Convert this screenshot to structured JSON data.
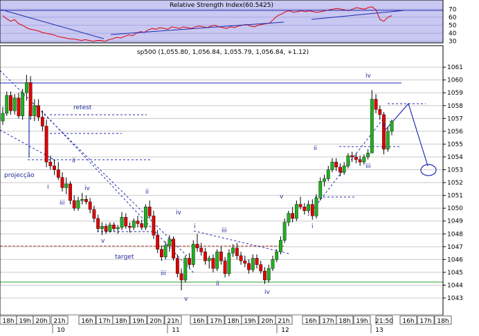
{
  "colors": {
    "rsi_bg": "#c8c8f2",
    "main_bg": "#ffffff",
    "grid": "#c8c8c8",
    "rsi_line": "#e00000",
    "trend": "#1f2ab0",
    "bull": "#21b021",
    "bear": "#e00000",
    "support": "#2aa02a",
    "target_line": "#b04020",
    "wick": "#000000"
  },
  "rsi_panel": {
    "title": "Relative Strength Index(60.5425)",
    "ticks": [
      "70",
      "60",
      "50",
      "40",
      "30"
    ]
  },
  "price_panel": {
    "title": "sp500 (1,055.80, 1,056.84, 1,055.79, 1,056.84, +1.12)",
    "price_ticks": [
      "1061",
      "1060",
      "1059",
      "1058",
      "1057",
      "1056",
      "1055",
      "1054",
      "1053",
      "1052",
      "1051",
      "1050",
      "1049",
      "1048",
      "1047",
      "1046",
      "1045",
      "1044",
      "1043"
    ]
  },
  "time_axis": {
    "hour_labels": [
      "18h",
      "19h",
      "20h",
      "21h",
      "16h",
      "17h",
      "18h",
      "19h",
      "20h",
      "21h",
      "16h",
      "17h",
      "18h",
      "19h",
      "20h",
      "21h",
      "16h",
      "17h",
      "18h",
      "19h",
      "21:50",
      "16h",
      "17h",
      "18h"
    ],
    "day_labels": [
      "10",
      "11",
      "12",
      "13"
    ]
  },
  "annotations": {
    "retest": "retest",
    "projeccao": "projecção",
    "target": "target",
    "waves": [
      "i",
      "ii",
      "iii",
      "iv",
      "v",
      "ii",
      "iii",
      "iv",
      "v",
      "i",
      "ii",
      "iii",
      "iv",
      "v",
      "i",
      "ii",
      "iii",
      "iv",
      "v"
    ]
  },
  "chart_data": {
    "type": "candlestick",
    "title": "sp500 (1,055.80, 1,056.84, 1,055.79, 1,056.84, +1.12)",
    "xlabel": "",
    "ylabel": "",
    "ylim": [
      1042.3,
      1061.6
    ],
    "candles": [
      {
        "o": 1056.8,
        "h": 1057.9,
        "l": 1056.5,
        "c": 1057.4
      },
      {
        "o": 1057.4,
        "h": 1059.1,
        "l": 1057.2,
        "c": 1058.8
      },
      {
        "o": 1058.8,
        "h": 1059.1,
        "l": 1057.3,
        "c": 1057.6
      },
      {
        "o": 1057.6,
        "h": 1058.9,
        "l": 1057.3,
        "c": 1058.6
      },
      {
        "o": 1058.6,
        "h": 1059.0,
        "l": 1057.0,
        "c": 1057.2
      },
      {
        "o": 1057.2,
        "h": 1059.3,
        "l": 1056.9,
        "c": 1059.0
      },
      {
        "o": 1059.0,
        "h": 1060.4,
        "l": 1058.4,
        "c": 1059.8
      },
      {
        "o": 1059.8,
        "h": 1060.3,
        "l": 1056.9,
        "c": 1057.2
      },
      {
        "o": 1057.2,
        "h": 1058.5,
        "l": 1056.8,
        "c": 1058.0
      },
      {
        "o": 1058.0,
        "h": 1058.5,
        "l": 1056.8,
        "c": 1057.1
      },
      {
        "o": 1057.1,
        "h": 1057.6,
        "l": 1056.0,
        "c": 1056.4
      },
      {
        "o": 1056.4,
        "h": 1056.9,
        "l": 1053.2,
        "c": 1053.6
      },
      {
        "o": 1053.6,
        "h": 1054.1,
        "l": 1053.0,
        "c": 1053.3
      },
      {
        "o": 1053.3,
        "h": 1053.8,
        "l": 1052.6,
        "c": 1053.0
      },
      {
        "o": 1053.0,
        "h": 1053.6,
        "l": 1052.2,
        "c": 1052.4
      },
      {
        "o": 1052.4,
        "h": 1052.8,
        "l": 1051.3,
        "c": 1051.6
      },
      {
        "o": 1051.6,
        "h": 1052.4,
        "l": 1051.1,
        "c": 1051.9
      },
      {
        "o": 1051.9,
        "h": 1052.1,
        "l": 1050.3,
        "c": 1050.6
      },
      {
        "o": 1050.6,
        "h": 1051.0,
        "l": 1049.8,
        "c": 1050.0
      },
      {
        "o": 1050.0,
        "h": 1050.9,
        "l": 1049.8,
        "c": 1050.6
      },
      {
        "o": 1050.6,
        "h": 1051.2,
        "l": 1050.3,
        "c": 1050.7
      },
      {
        "o": 1050.7,
        "h": 1051.0,
        "l": 1050.3,
        "c": 1050.5
      },
      {
        "o": 1050.5,
        "h": 1050.8,
        "l": 1049.6,
        "c": 1049.9
      },
      {
        "o": 1049.9,
        "h": 1050.2,
        "l": 1048.9,
        "c": 1049.2
      },
      {
        "o": 1049.2,
        "h": 1049.5,
        "l": 1048.2,
        "c": 1048.4
      },
      {
        "o": 1048.4,
        "h": 1048.9,
        "l": 1047.9,
        "c": 1048.6
      },
      {
        "o": 1048.6,
        "h": 1048.8,
        "l": 1048.0,
        "c": 1048.2
      },
      {
        "o": 1048.2,
        "h": 1048.9,
        "l": 1048.1,
        "c": 1048.7
      },
      {
        "o": 1048.7,
        "h": 1048.9,
        "l": 1048.2,
        "c": 1048.4
      },
      {
        "o": 1048.4,
        "h": 1048.7,
        "l": 1048.0,
        "c": 1048.5
      },
      {
        "o": 1048.5,
        "h": 1049.7,
        "l": 1048.3,
        "c": 1049.3
      },
      {
        "o": 1049.3,
        "h": 1049.6,
        "l": 1048.4,
        "c": 1048.6
      },
      {
        "o": 1048.6,
        "h": 1048.9,
        "l": 1048.1,
        "c": 1048.5
      },
      {
        "o": 1048.5,
        "h": 1049.2,
        "l": 1048.3,
        "c": 1049.0
      },
      {
        "o": 1049.0,
        "h": 1049.4,
        "l": 1048.5,
        "c": 1048.8
      },
      {
        "o": 1048.8,
        "h": 1049.1,
        "l": 1048.3,
        "c": 1048.5
      },
      {
        "o": 1048.5,
        "h": 1050.3,
        "l": 1048.3,
        "c": 1050.1
      },
      {
        "o": 1050.1,
        "h": 1050.6,
        "l": 1049.2,
        "c": 1049.4
      },
      {
        "o": 1049.4,
        "h": 1049.8,
        "l": 1047.6,
        "c": 1047.9
      },
      {
        "o": 1047.9,
        "h": 1048.3,
        "l": 1046.5,
        "c": 1046.8
      },
      {
        "o": 1046.8,
        "h": 1047.1,
        "l": 1045.9,
        "c": 1046.2
      },
      {
        "o": 1046.2,
        "h": 1047.4,
        "l": 1046.0,
        "c": 1047.1
      },
      {
        "o": 1047.1,
        "h": 1047.9,
        "l": 1046.6,
        "c": 1047.6
      },
      {
        "o": 1047.6,
        "h": 1047.8,
        "l": 1045.9,
        "c": 1046.1
      },
      {
        "o": 1046.1,
        "h": 1046.4,
        "l": 1044.6,
        "c": 1044.9
      },
      {
        "o": 1044.9,
        "h": 1045.3,
        "l": 1043.6,
        "c": 1044.4
      },
      {
        "o": 1044.4,
        "h": 1046.3,
        "l": 1044.2,
        "c": 1046.1
      },
      {
        "o": 1046.1,
        "h": 1046.5,
        "l": 1045.3,
        "c": 1045.6
      },
      {
        "o": 1045.6,
        "h": 1047.5,
        "l": 1045.4,
        "c": 1047.2
      },
      {
        "o": 1047.2,
        "h": 1048.0,
        "l": 1046.6,
        "c": 1046.9
      },
      {
        "o": 1046.9,
        "h": 1047.3,
        "l": 1046.3,
        "c": 1046.6
      },
      {
        "o": 1046.6,
        "h": 1046.9,
        "l": 1045.6,
        "c": 1045.9
      },
      {
        "o": 1045.9,
        "h": 1046.3,
        "l": 1045.3,
        "c": 1046.1
      },
      {
        "o": 1046.1,
        "h": 1046.4,
        "l": 1045.0,
        "c": 1045.3
      },
      {
        "o": 1045.3,
        "h": 1046.8,
        "l": 1045.1,
        "c": 1046.6
      },
      {
        "o": 1046.6,
        "h": 1047.0,
        "l": 1045.6,
        "c": 1045.9
      },
      {
        "o": 1045.9,
        "h": 1046.2,
        "l": 1044.6,
        "c": 1044.9
      },
      {
        "o": 1044.9,
        "h": 1046.8,
        "l": 1044.7,
        "c": 1046.5
      },
      {
        "o": 1046.5,
        "h": 1047.2,
        "l": 1046.2,
        "c": 1046.9
      },
      {
        "o": 1046.9,
        "h": 1047.3,
        "l": 1046.0,
        "c": 1046.3
      },
      {
        "o": 1046.3,
        "h": 1046.6,
        "l": 1045.6,
        "c": 1045.9
      },
      {
        "o": 1045.9,
        "h": 1046.3,
        "l": 1045.4,
        "c": 1045.7
      },
      {
        "o": 1045.7,
        "h": 1046.0,
        "l": 1044.9,
        "c": 1045.2
      },
      {
        "o": 1045.2,
        "h": 1046.4,
        "l": 1045.0,
        "c": 1046.1
      },
      {
        "o": 1046.1,
        "h": 1046.4,
        "l": 1045.3,
        "c": 1045.6
      },
      {
        "o": 1045.6,
        "h": 1045.9,
        "l": 1044.9,
        "c": 1045.1
      },
      {
        "o": 1045.1,
        "h": 1045.4,
        "l": 1044.1,
        "c": 1044.4
      },
      {
        "o": 1044.4,
        "h": 1045.6,
        "l": 1044.2,
        "c": 1045.3
      },
      {
        "o": 1045.3,
        "h": 1046.3,
        "l": 1045.1,
        "c": 1046.0
      },
      {
        "o": 1046.0,
        "h": 1046.8,
        "l": 1045.8,
        "c": 1046.6
      },
      {
        "o": 1046.6,
        "h": 1047.8,
        "l": 1046.4,
        "c": 1047.5
      },
      {
        "o": 1047.5,
        "h": 1049.2,
        "l": 1047.3,
        "c": 1048.9
      },
      {
        "o": 1048.9,
        "h": 1049.8,
        "l": 1048.6,
        "c": 1049.6
      },
      {
        "o": 1049.6,
        "h": 1050.1,
        "l": 1048.9,
        "c": 1049.2
      },
      {
        "o": 1049.2,
        "h": 1050.6,
        "l": 1049.0,
        "c": 1050.3
      },
      {
        "o": 1050.3,
        "h": 1050.9,
        "l": 1049.9,
        "c": 1050.1
      },
      {
        "o": 1050.1,
        "h": 1050.4,
        "l": 1049.5,
        "c": 1049.8
      },
      {
        "o": 1049.8,
        "h": 1050.6,
        "l": 1049.6,
        "c": 1050.3
      },
      {
        "o": 1050.3,
        "h": 1050.7,
        "l": 1049.1,
        "c": 1049.4
      },
      {
        "o": 1049.4,
        "h": 1051.1,
        "l": 1049.2,
        "c": 1050.8
      },
      {
        "o": 1050.8,
        "h": 1052.4,
        "l": 1050.6,
        "c": 1052.1
      },
      {
        "o": 1052.1,
        "h": 1052.6,
        "l": 1051.7,
        "c": 1052.3
      },
      {
        "o": 1052.3,
        "h": 1053.3,
        "l": 1052.1,
        "c": 1053.0
      },
      {
        "o": 1053.0,
        "h": 1053.9,
        "l": 1052.8,
        "c": 1053.6
      },
      {
        "o": 1053.6,
        "h": 1053.9,
        "l": 1052.9,
        "c": 1053.2
      },
      {
        "o": 1053.2,
        "h": 1053.5,
        "l": 1052.5,
        "c": 1052.8
      },
      {
        "o": 1052.8,
        "h": 1053.6,
        "l": 1052.6,
        "c": 1053.3
      },
      {
        "o": 1053.3,
        "h": 1054.3,
        "l": 1053.1,
        "c": 1054.1
      },
      {
        "o": 1054.1,
        "h": 1054.4,
        "l": 1053.6,
        "c": 1054.0
      },
      {
        "o": 1054.0,
        "h": 1054.3,
        "l": 1053.5,
        "c": 1053.8
      },
      {
        "o": 1053.8,
        "h": 1054.1,
        "l": 1053.3,
        "c": 1053.6
      },
      {
        "o": 1053.6,
        "h": 1054.2,
        "l": 1053.4,
        "c": 1054.0
      },
      {
        "o": 1054.0,
        "h": 1054.6,
        "l": 1053.8,
        "c": 1054.3
      },
      {
        "o": 1054.3,
        "h": 1059.2,
        "l": 1058.0,
        "c": 1058.5
      },
      {
        "o": 1058.5,
        "h": 1058.9,
        "l": 1057.4,
        "c": 1057.7
      },
      {
        "o": 1057.7,
        "h": 1058.0,
        "l": 1056.9,
        "c": 1057.3
      },
      {
        "o": 1057.3,
        "h": 1057.5,
        "l": 1054.2,
        "c": 1054.6
      },
      {
        "o": 1054.6,
        "h": 1056.3,
        "l": 1054.4,
        "c": 1056.0
      },
      {
        "o": 1056.0,
        "h": 1056.9,
        "l": 1055.7,
        "c": 1056.8
      }
    ],
    "rsi_series": [
      62,
      58,
      55,
      57,
      52,
      50,
      47,
      45,
      44,
      43,
      41,
      40,
      39,
      38,
      36,
      35,
      34,
      33,
      33,
      32,
      31,
      32,
      31,
      30,
      31,
      31,
      30,
      32,
      33,
      35,
      34,
      36,
      38,
      37,
      40,
      42,
      41,
      44,
      46,
      45,
      47,
      46,
      45,
      48,
      47,
      46,
      48,
      47,
      46,
      48,
      49,
      48,
      47,
      49,
      50,
      48,
      47,
      46,
      48,
      47,
      49,
      50,
      51,
      49,
      48,
      50,
      51,
      52,
      53,
      58,
      62,
      64,
      67,
      68,
      66,
      67,
      68,
      67,
      68,
      67,
      66,
      67,
      68,
      69,
      70,
      71,
      70,
      69,
      68,
      70,
      72,
      71,
      70,
      72,
      73,
      69,
      57,
      55,
      60,
      62
    ],
    "rsi_ylim": [
      28,
      78
    ]
  }
}
